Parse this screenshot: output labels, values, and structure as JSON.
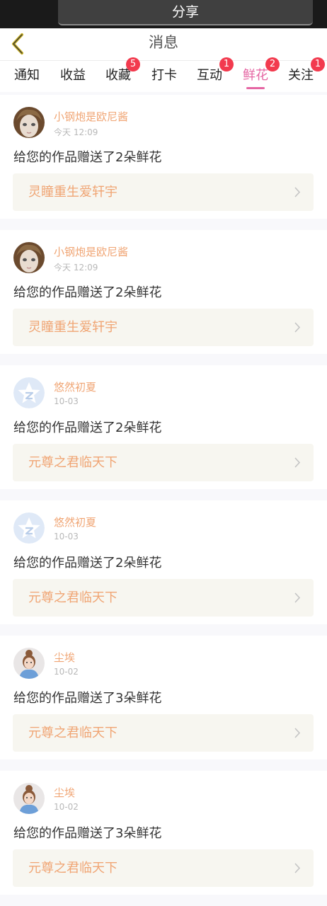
{
  "topbar": {
    "share_label": "分享"
  },
  "header": {
    "title": "消息"
  },
  "tabs": [
    {
      "label": "通知",
      "badge": ""
    },
    {
      "label": "收益",
      "badge": ""
    },
    {
      "label": "收藏",
      "badge": "5"
    },
    {
      "label": "打卡",
      "badge": ""
    },
    {
      "label": "互动",
      "badge": "1"
    },
    {
      "label": "鲜花",
      "badge": "2",
      "active": true
    },
    {
      "label": "关注",
      "badge": "1"
    }
  ],
  "colors": {
    "accent": "#e566a3",
    "name": "#f0a574",
    "badge": "#f23a4e"
  },
  "messages": [
    {
      "user": "小钢炮是欧尼酱",
      "time": "今天 12:09",
      "text": "给您的作品赠送了2朵鲜花",
      "work": "灵瞳重生爱轩宇",
      "avatar": "doll-avatar"
    },
    {
      "user": "小钢炮是欧尼酱",
      "time": "今天 12:09",
      "text": "给您的作品赠送了2朵鲜花",
      "work": "灵瞳重生爱轩宇",
      "avatar": "doll-avatar"
    },
    {
      "user": "悠然初夏",
      "time": "10-03",
      "text": "给您的作品赠送了2朵鲜花",
      "work": "元尊之君临天下",
      "avatar": "default-star-avatar"
    },
    {
      "user": "悠然初夏",
      "time": "10-03",
      "text": "给您的作品赠送了2朵鲜花",
      "work": "元尊之君临天下",
      "avatar": "default-star-avatar"
    },
    {
      "user": "尘埃",
      "time": "10-02",
      "text": "给您的作品赠送了3朵鲜花",
      "work": "元尊之君临天下",
      "avatar": "girl-avatar"
    },
    {
      "user": "尘埃",
      "time": "10-02",
      "text": "给您的作品赠送了3朵鲜花",
      "work": "元尊之君临天下",
      "avatar": "girl-avatar"
    }
  ]
}
